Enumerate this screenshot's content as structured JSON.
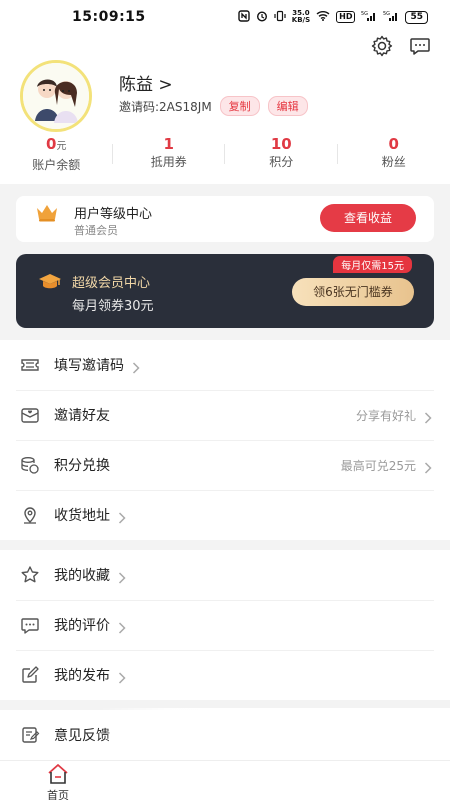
{
  "status_bar": {
    "time": "15:09:15",
    "speed_value": "35.0",
    "speed_unit": "KB/S",
    "hd_label": "HD",
    "signal_label": "5G",
    "battery": "55"
  },
  "profile": {
    "name": "陈益 >",
    "invite_label": "邀请码:2AS18JM",
    "copy_button": "复制",
    "edit_button": "编辑"
  },
  "stats": [
    {
      "value": "0",
      "unit": "元",
      "label": "账户余额"
    },
    {
      "value": "1",
      "unit": "",
      "label": "抵用券"
    },
    {
      "value": "10",
      "unit": "",
      "label": "积分"
    },
    {
      "value": "0",
      "unit": "",
      "label": "粉丝"
    }
  ],
  "level_card": {
    "title": "用户等级中心",
    "subtitle": "普通会员",
    "button": "查看收益"
  },
  "vip_card": {
    "title": "超级会员中心",
    "subtitle": "每月领券30元",
    "badge": "每月仅需15元",
    "button": "领6张无门槛券"
  },
  "menu_group_1": [
    {
      "label": "填写邀请码",
      "extra": "",
      "icon": "ticket-icon"
    },
    {
      "label": "邀请好友",
      "extra": "分享有好礼",
      "icon": "envelope-icon"
    },
    {
      "label": "积分兑换",
      "extra": "最高可兑25元",
      "icon": "coins-icon"
    },
    {
      "label": "收货地址",
      "extra": "",
      "icon": "location-pin-icon"
    }
  ],
  "menu_group_2": [
    {
      "label": "我的收藏",
      "extra": "",
      "icon": "star-icon"
    },
    {
      "label": "我的评价",
      "extra": "",
      "icon": "chat-bubble-icon"
    },
    {
      "label": "我的发布",
      "extra": "",
      "icon": "edit-icon"
    }
  ],
  "menu_group_3": [
    {
      "label": "意见反馈",
      "extra": "",
      "icon": "feedback-icon"
    }
  ],
  "tabbar": {
    "home_label": "首页"
  },
  "colors": {
    "accent": "#e53b46",
    "vip_bg": "#2a2f3a",
    "vip_gold": "#e8c38e"
  }
}
